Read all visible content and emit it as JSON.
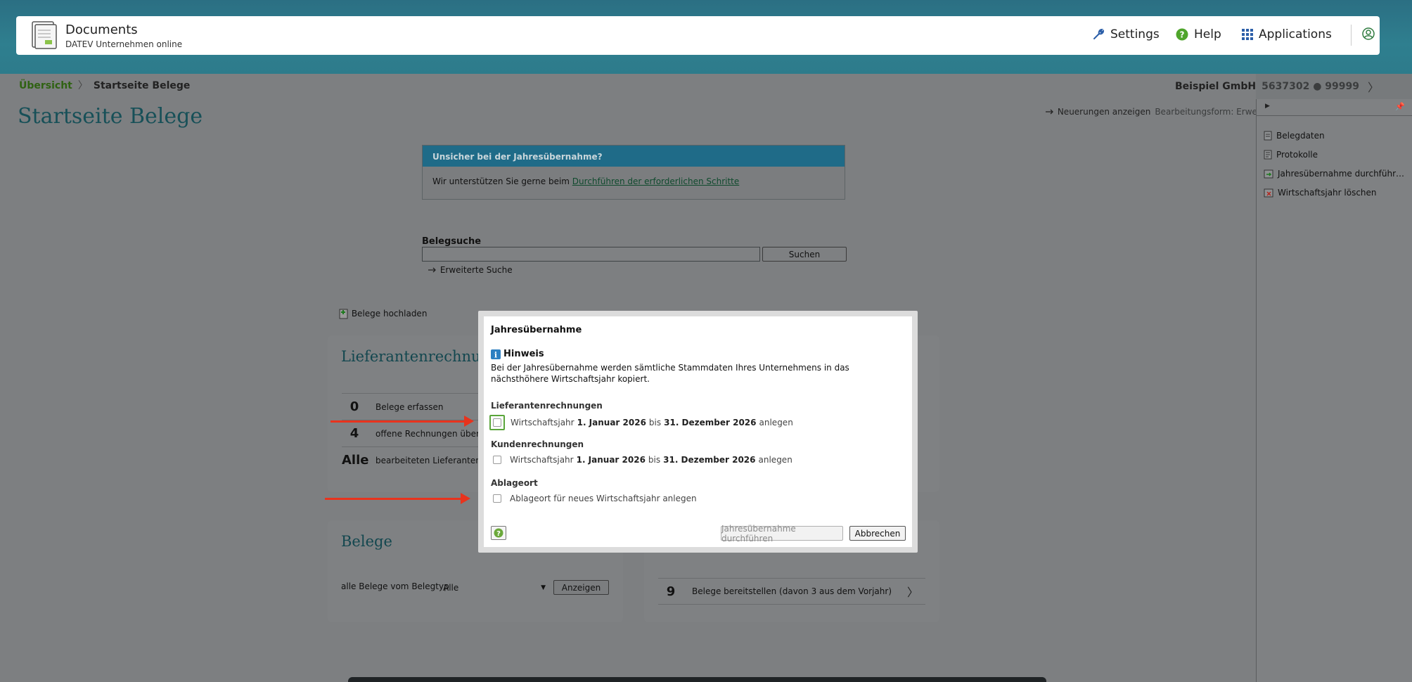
{
  "header": {
    "app_title": "Documents",
    "app_subtitle": "DATEV Unternehmen online",
    "settings": "Settings",
    "help": "Help",
    "applications": "Applications"
  },
  "breadcrumb": {
    "home": "Übersicht",
    "current": "Startseite Belege"
  },
  "company": {
    "name": "Beispiel GmbH",
    "numbers": "5637302 ● 99999"
  },
  "page_title": "Startseite Belege",
  "neuerungen": {
    "label": "Neuerungen anzeigen",
    "form": "Bearbeitungsform: Erweitert"
  },
  "infobox": {
    "title": "Unsicher bei der Jahresübernahme?",
    "text": "Wir unterstützen Sie gerne beim ",
    "link": "Durchführen der erforderlichen Schritte"
  },
  "search": {
    "label": "Belegsuche",
    "value": "",
    "button": "Suchen",
    "advanced": "Erweiterte Suche"
  },
  "upload": "Belege hochladen",
  "cards": {
    "lieferanten": {
      "title": "Lieferantenrechnun",
      "rows": [
        {
          "num": "0",
          "text": "Belege erfassen"
        },
        {
          "num": "4",
          "text": "offene Rechnungen überwe"
        },
        {
          "num": "Alle",
          "text": "bearbeiteten Lieferantenre"
        }
      ]
    },
    "belege": {
      "title": "Belege",
      "belegtyp_label": "alle Belege vom Belegtyp",
      "belegtyp_value": "Alle",
      "button": "Anzeigen"
    },
    "kunden": {
      "rows": [
        {
          "num": "9",
          "text": "Belege bereitstellen (davon 3 aus dem Vorjahr)"
        }
      ]
    }
  },
  "side": {
    "items": [
      "Belegdaten",
      "Protokolle",
      "Jahresübernahme durchführ…",
      "Wirtschaftsjahr löschen"
    ]
  },
  "modal": {
    "title": "Jahresübernahme",
    "hinweis": "Hinweis",
    "description": "Bei der Jahresübernahme werden sämtliche Stammdaten Ihres Unternehmens in das nächsthöhere Wirtschaftsjahr kopiert.",
    "sec1": "Lieferantenrechnungen",
    "sec2": "Kundenrechnungen",
    "sec3": "Ablageort",
    "opt_prefix": "Wirtschaftsjahr",
    "opt_from": "1. Januar 2026",
    "opt_mid": "bis",
    "opt_to": "31. Dezember 2026",
    "opt_suffix": "anlegen",
    "opt3": "Ablageort für neues Wirtschaftsjahr anlegen",
    "btn_run": "Jahresübernahme durchführen",
    "btn_cancel": "Abbrechen"
  },
  "colors": {
    "accent": "#175058",
    "focus": "#5aa53b",
    "annotation": "#e8331d"
  }
}
